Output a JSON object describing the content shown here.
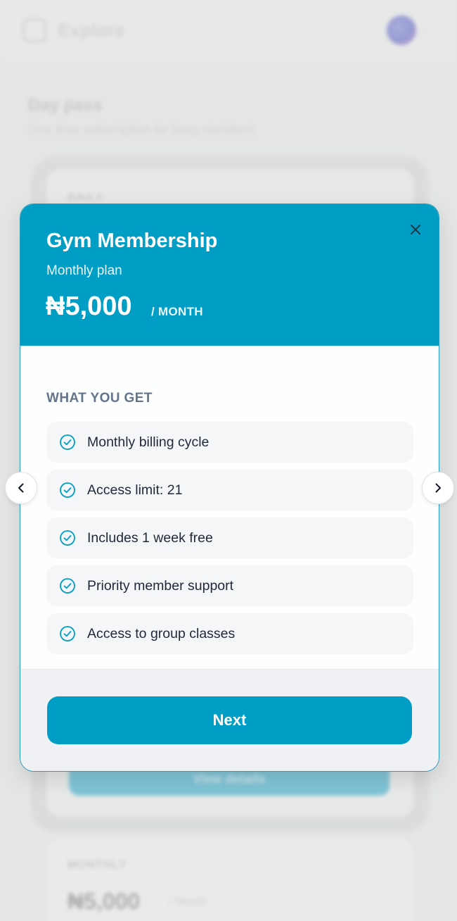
{
  "background": {
    "app_title": "Explore",
    "section_title": "Day pass",
    "section_subtitle": "One time subscription for busy members",
    "card_label": "DAILY",
    "card_button": "View details",
    "card2_label": "MONTHLY",
    "card2_price": "₦5,000",
    "card2_period": "/ Month"
  },
  "modal": {
    "title": "Gym Membership",
    "subtitle": "Monthly plan",
    "price": "₦5,000",
    "period": "/ MONTH",
    "close_icon": "close-icon",
    "section_label": "WHAT YOU GET",
    "features": [
      {
        "label": "Monthly billing cycle",
        "icon": "check-circle-icon"
      },
      {
        "label": "Access limit: 21",
        "icon": "check-circle-icon"
      },
      {
        "label": "Includes 1 week free",
        "icon": "check-circle-icon"
      },
      {
        "label": "Priority member support",
        "icon": "check-circle-icon"
      },
      {
        "label": "Access to group classes",
        "icon": "check-circle-icon"
      }
    ],
    "next_label": "Next"
  },
  "carousel": {
    "prev_icon": "chevron-left-icon",
    "next_icon": "chevron-right-icon"
  },
  "colors": {
    "accent": "#009dc4",
    "text_muted": "#64748b"
  }
}
